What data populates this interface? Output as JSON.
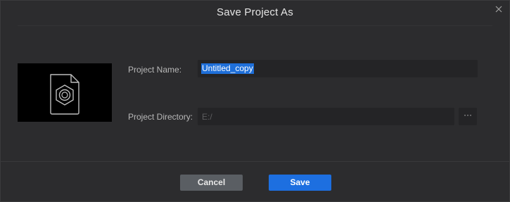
{
  "dialog": {
    "title": "Save Project As",
    "close_icon": "close-icon"
  },
  "thumbnail": {
    "icon": "project-file-icon"
  },
  "form": {
    "project_name_label": "Project Name:",
    "project_name_value": "Untitled_copy",
    "project_directory_label": "Project Directory:",
    "project_directory_placeholder": "E:/",
    "browse_label": "···"
  },
  "footer": {
    "cancel_label": "Cancel",
    "save_label": "Save"
  },
  "colors": {
    "background": "#2c2c2e",
    "field_background": "#242426",
    "selection": "#1e6fd9",
    "save_button": "#1d6fe0",
    "cancel_button": "#5a5e63"
  }
}
